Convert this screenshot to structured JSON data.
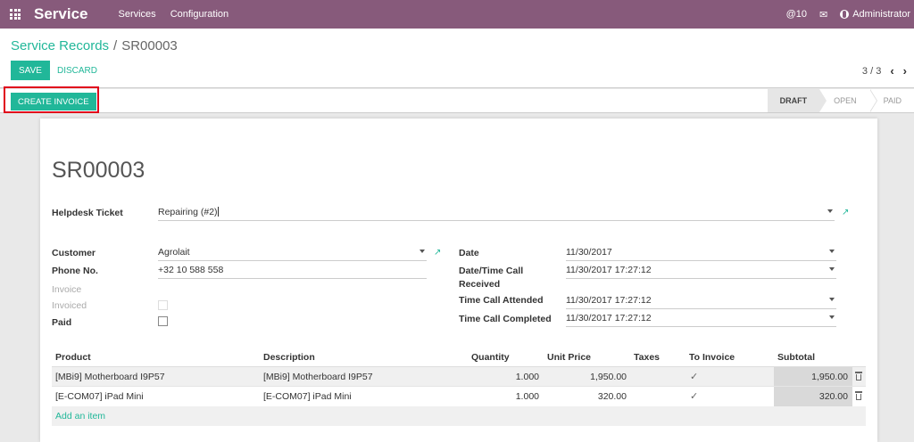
{
  "navbar": {
    "app_name": "Service",
    "menu": [
      "Services",
      "Configuration"
    ],
    "mentions": "@10",
    "user": "Administrator"
  },
  "control": {
    "breadcrumb_parent": "Service Records",
    "breadcrumb_sep": "/",
    "breadcrumb_current": "SR00003",
    "save_label": "SAVE",
    "discard_label": "DISCARD",
    "pager": "3 / 3"
  },
  "statusbar": {
    "create_invoice_label": "CREATE INVOICE",
    "stages": [
      "DRAFT",
      "OPEN",
      "PAID"
    ],
    "active_stage": "DRAFT"
  },
  "form": {
    "title": "SR00003",
    "helpdesk_ticket_label": "Helpdesk Ticket",
    "helpdesk_ticket_value": "Repairing (#2)",
    "customer_label": "Customer",
    "customer_value": "Agrolait",
    "phone_label": "Phone No.",
    "phone_value": "+32 10 588 558",
    "invoice_label": "Invoice",
    "invoiced_label": "Invoiced",
    "paid_label": "Paid",
    "date_label": "Date",
    "date_value": "11/30/2017",
    "call_received_label_1": "Date/Time Call",
    "call_received_label_2": "Received",
    "call_received_value": "11/30/2017 17:27:12",
    "call_attended_label": "Time Call Attended",
    "call_attended_value": "11/30/2017 17:27:12",
    "call_completed_label": "Time Call Completed",
    "call_completed_value": "11/30/2017 17:27:12"
  },
  "table": {
    "headers": {
      "product": "Product",
      "description": "Description",
      "quantity": "Quantity",
      "unit_price": "Unit Price",
      "taxes": "Taxes",
      "to_invoice": "To Invoice",
      "subtotal": "Subtotal"
    },
    "rows": [
      {
        "product": "[MBi9] Motherboard I9P57",
        "description": "[MBi9] Motherboard I9P57",
        "quantity": "1.000",
        "unit_price": "1,950.00",
        "taxes": "",
        "to_invoice": true,
        "subtotal": "1,950.00"
      },
      {
        "product": "[E-COM07] iPad Mini",
        "description": "[E-COM07] iPad Mini",
        "quantity": "1.000",
        "unit_price": "320.00",
        "taxes": "",
        "to_invoice": true,
        "subtotal": "320.00"
      }
    ],
    "add_item_label": "Add an item"
  },
  "colors": {
    "navbar": "#875a7b",
    "accent": "#21b799",
    "highlight_border": "#e0001b"
  }
}
